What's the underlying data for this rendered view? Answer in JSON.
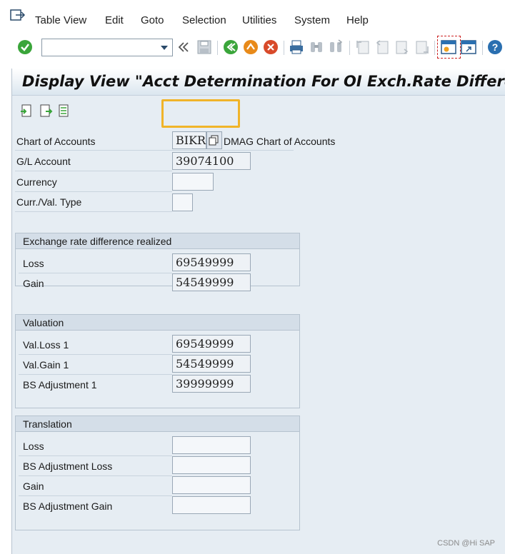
{
  "menubar": {
    "icon": "exit-menu-icon",
    "items": [
      {
        "label": "Table View"
      },
      {
        "label": "Edit"
      },
      {
        "label": "Goto"
      },
      {
        "label": "Selection"
      },
      {
        "label": "Utilities"
      },
      {
        "label": "System"
      },
      {
        "label": "Help"
      }
    ]
  },
  "toolbar": {
    "command_field": "",
    "icons": [
      "enter-check-icon",
      "dropdown-arrow-icon",
      "double-chevron-left-icon",
      "save-icon",
      "back-icon",
      "exit-icon",
      "cancel-icon",
      "print-icon",
      "find-icon",
      "find-next-icon",
      "first-page-icon",
      "previous-page-icon",
      "next-page-icon",
      "last-page-icon",
      "create-session-icon",
      "generate-shortcut-icon",
      "help-icon"
    ]
  },
  "title": "Display View \"Acct Determination For OI Exch.Rate Differences\"",
  "app_toolbar": {
    "icons": [
      "previous-entry-icon",
      "next-entry-icon",
      "other-entry-icon"
    ]
  },
  "header_fields": {
    "chart_of_accounts": {
      "label": "Chart of Accounts",
      "value": "BIKR",
      "description": "DMAG Chart of Accounts"
    },
    "gl_account": {
      "label": "G/L Account",
      "value": "39074100"
    },
    "currency": {
      "label": "Currency",
      "value": ""
    },
    "curr_val_type": {
      "label": "Curr./Val. Type",
      "value": ""
    }
  },
  "realized": {
    "title": "Exchange rate difference realized",
    "loss": {
      "label": "Loss",
      "value": "69549999"
    },
    "gain": {
      "label": "Gain",
      "value": "54549999"
    }
  },
  "valuation": {
    "title": "Valuation",
    "val_loss_1": {
      "label": "Val.Loss 1",
      "value": "69549999"
    },
    "val_gain_1": {
      "label": "Val.Gain 1",
      "value": "54549999"
    },
    "bs_adjustment_1": {
      "label": "BS Adjustment 1",
      "value": "39999999"
    }
  },
  "translation": {
    "title": "Translation",
    "loss": {
      "label": "Loss",
      "value": ""
    },
    "bs_adjustment_loss": {
      "label": "BS Adjustment Loss",
      "value": ""
    },
    "gain": {
      "label": "Gain",
      "value": ""
    },
    "bs_adjustment_gain": {
      "label": "BS Adjustment Gain",
      "value": ""
    }
  },
  "watermark": "CSDN @Hi SAP",
  "colors": {
    "highlight": "#f0b429",
    "check_green": "#3aa53a",
    "exit_orange": "#e88a1a",
    "cancel_red": "#d84a2a",
    "help_blue": "#2a6fb0"
  }
}
